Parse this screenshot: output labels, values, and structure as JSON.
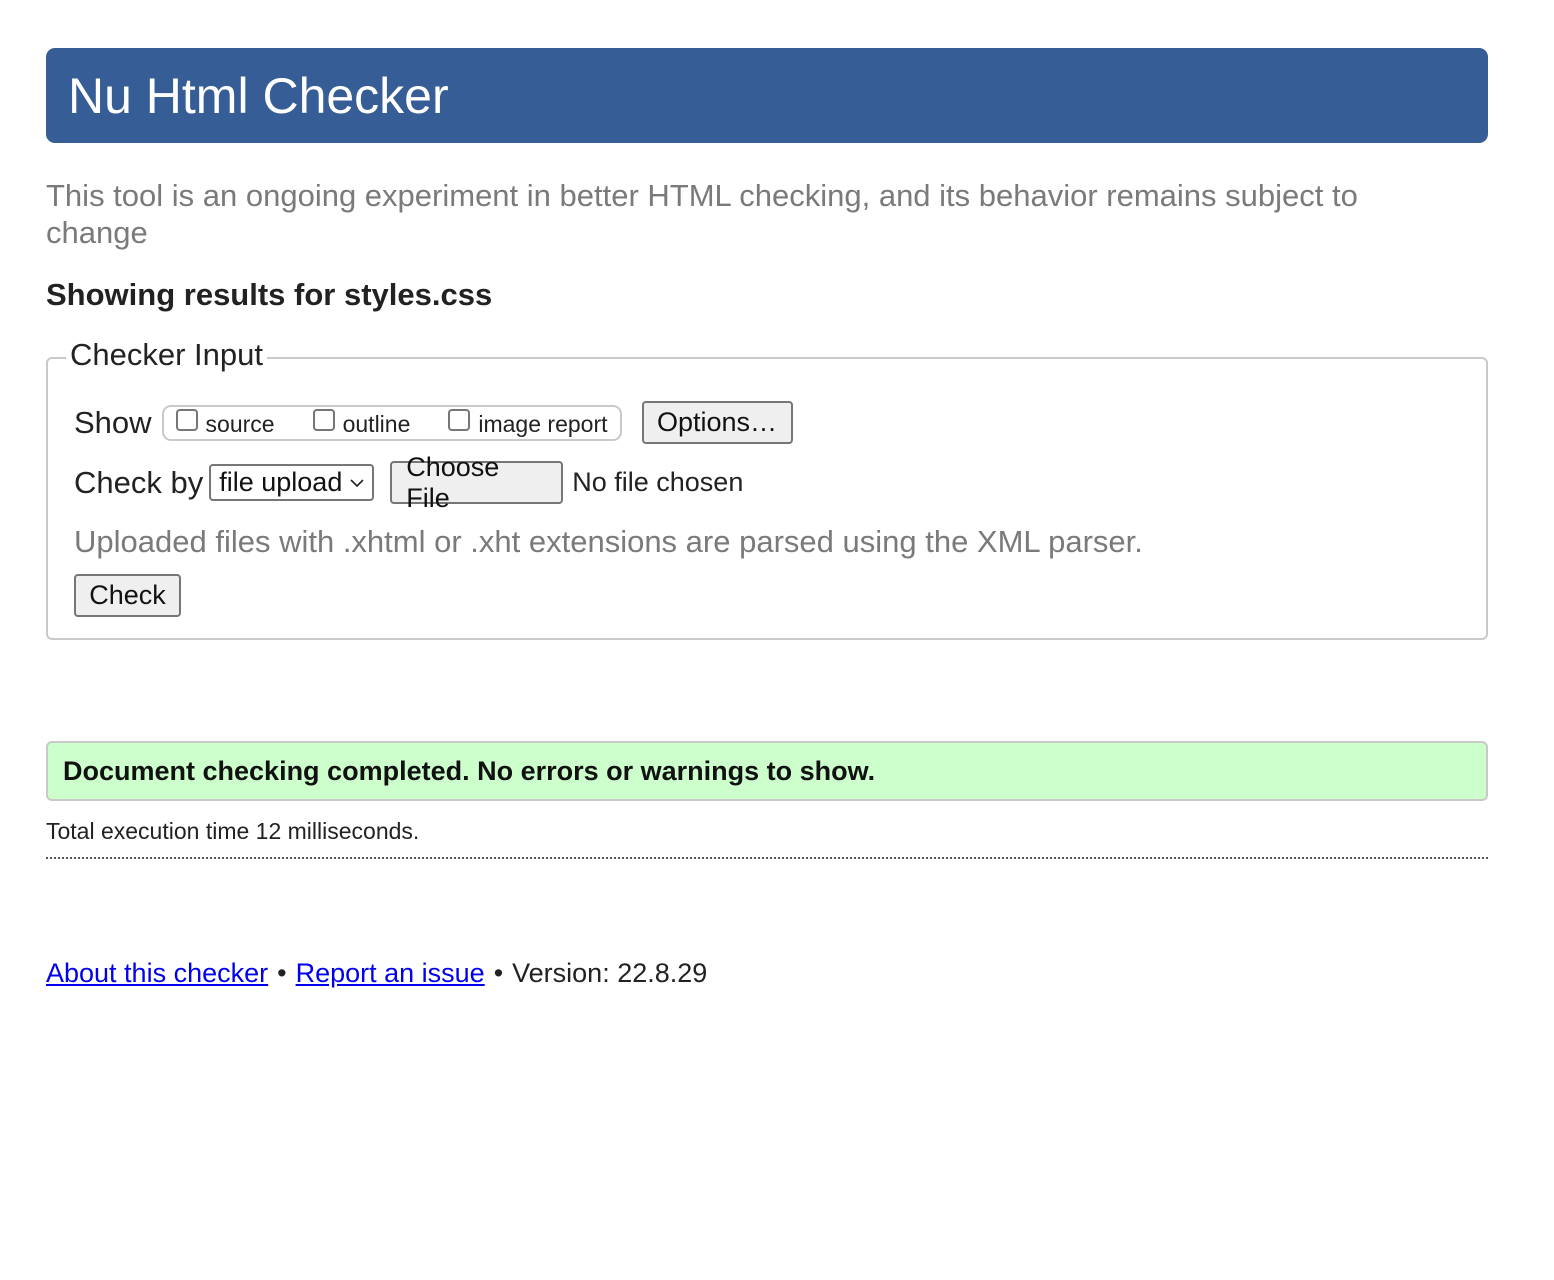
{
  "header": {
    "title": "Nu Html Checker"
  },
  "intro": {
    "text": "This tool is an ongoing experiment in better HTML checking, and its behavior remains subject to change"
  },
  "results": {
    "heading": "Showing results for styles.css"
  },
  "checker_input": {
    "legend": "Checker Input",
    "show_label": "Show",
    "show_options": [
      {
        "label": "source",
        "checked": false
      },
      {
        "label": "outline",
        "checked": false
      },
      {
        "label": "image report",
        "checked": false
      }
    ],
    "options_button": "Options…",
    "check_by_label": "Check by",
    "check_by_selected": "file upload",
    "choose_file_button": "Choose File",
    "no_file_text": "No file chosen",
    "note": "Uploaded files with .xhtml or .xht extensions are parsed using the XML parser.",
    "check_button": "Check"
  },
  "status": {
    "message": "Document checking completed. No errors or warnings to show.",
    "execution_time": "Total execution time 12 milliseconds."
  },
  "footer": {
    "about_link": "About this checker",
    "separator": "•",
    "report_link": "Report an issue",
    "version_text": "Version: 22.8.29"
  },
  "colors": {
    "header_bg": "#365d95",
    "success_bg": "#ccffcc",
    "link": "#0000ee",
    "muted_text": "#7a7a7a"
  },
  "icons": {
    "select_arrow": "chevron-down-icon"
  }
}
